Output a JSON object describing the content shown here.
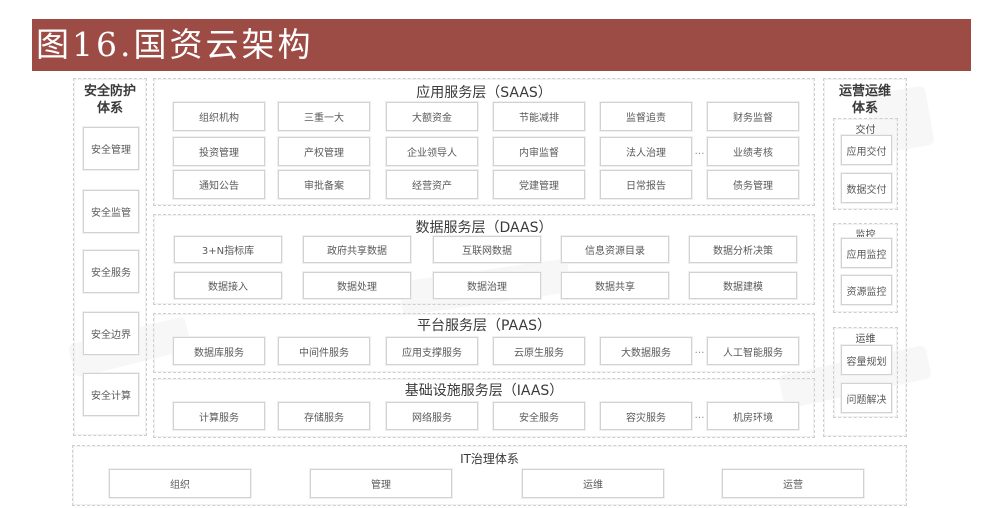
{
  "title": "图16.国资云架构",
  "ellipsis": "…",
  "left_panel": {
    "title_lines": [
      "安全防护",
      "体系"
    ],
    "items": [
      "安全管理",
      "安全监管",
      "安全服务",
      "安全边界",
      "安全计算"
    ]
  },
  "layers": [
    {
      "title": "应用服务层（SAAS）",
      "rows": [
        {
          "items": [
            "组织机构",
            "三重一大",
            "大额资金",
            "节能减排",
            "监督追责",
            "财务监督"
          ],
          "ellipsis_before_last": false
        },
        {
          "items": [
            "投资管理",
            "产权管理",
            "企业领导人",
            "内审监督",
            "法人治理",
            "业绩考核"
          ],
          "ellipsis_before_last": true
        },
        {
          "items": [
            "通知公告",
            "审批备案",
            "经营资产",
            "党建管理",
            "日常报告",
            "债务管理"
          ],
          "ellipsis_before_last": false
        }
      ]
    },
    {
      "title": "数据服务层（DAAS）",
      "rows": [
        {
          "items": [
            "3+N指标库",
            "政府共享数据",
            "互联网数据",
            "信息资源目录",
            "数据分析决策"
          ],
          "ellipsis_before_last": false
        },
        {
          "items": [
            "数据接入",
            "数据处理",
            "数据治理",
            "数据共享",
            "数据建模"
          ],
          "ellipsis_before_last": false
        }
      ]
    },
    {
      "title": "平台服务层（PAAS）",
      "rows": [
        {
          "items": [
            "数据库服务",
            "中间件服务",
            "应用支撑服务",
            "云原生服务",
            "大数据服务",
            "人工智能服务"
          ],
          "ellipsis_before_last": true
        }
      ]
    },
    {
      "title": "基础设施服务层（IAAS）",
      "rows": [
        {
          "items": [
            "计算服务",
            "存储服务",
            "网络服务",
            "安全服务",
            "容灾服务",
            "机房环境"
          ],
          "ellipsis_before_last": true
        }
      ]
    }
  ],
  "right_panel": {
    "title_lines": [
      "运营运维",
      "体系"
    ],
    "groups": [
      {
        "label": "交付",
        "items": [
          "应用交付",
          "数据交付"
        ]
      },
      {
        "label": "监控",
        "items": [
          "应用监控",
          "资源监控"
        ]
      },
      {
        "label": "运维",
        "items": [
          "容量规划",
          "问题解决"
        ]
      }
    ]
  },
  "governance": {
    "title": "IT治理体系",
    "items": [
      "组织",
      "管理",
      "运维",
      "运营"
    ]
  },
  "colors": {
    "title_bar": "#9c4b45",
    "title_text": "#ffffff",
    "box_border": "#d2d2d2",
    "item_text": "#5a5a5a"
  }
}
